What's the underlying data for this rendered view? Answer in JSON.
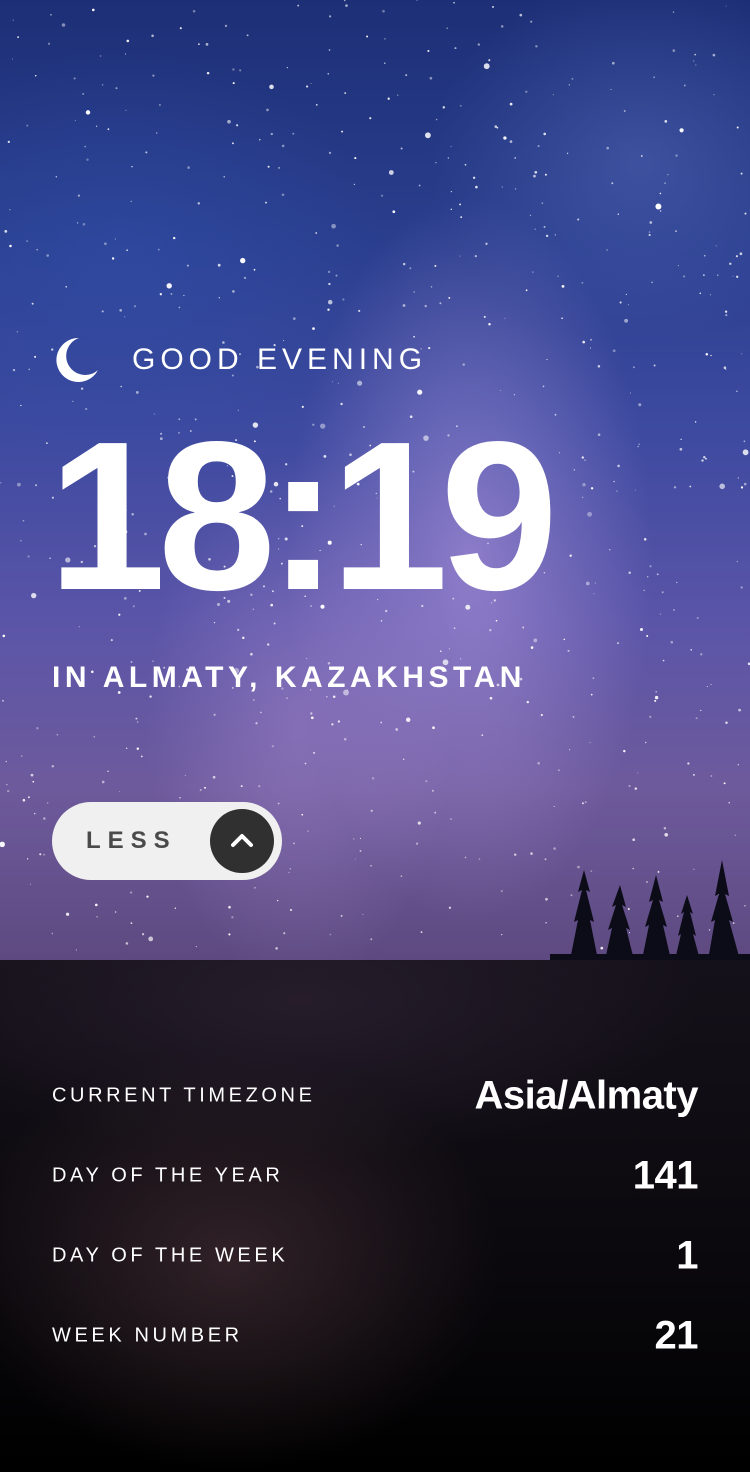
{
  "greeting": {
    "icon": "moon-icon",
    "text": "GOOD EVENING"
  },
  "clock": {
    "time": "18:19"
  },
  "location": {
    "text": "IN ALMATY, KAZAKHSTAN"
  },
  "toggle": {
    "label": "LESS",
    "icon": "chevron-up-icon"
  },
  "details": {
    "rows": [
      {
        "label": "CURRENT TIMEZONE",
        "value": "Asia/Almaty"
      },
      {
        "label": "DAY OF THE YEAR",
        "value": "141"
      },
      {
        "label": "DAY OF THE WEEK",
        "value": "1"
      },
      {
        "label": "WEEK NUMBER",
        "value": "21"
      }
    ]
  },
  "colors": {
    "text": "#ffffff",
    "toggle_bg": "#f0f0f0",
    "toggle_circle": "#303030",
    "toggle_text": "#4a4a4a",
    "panel_bg": "#0b090e"
  }
}
